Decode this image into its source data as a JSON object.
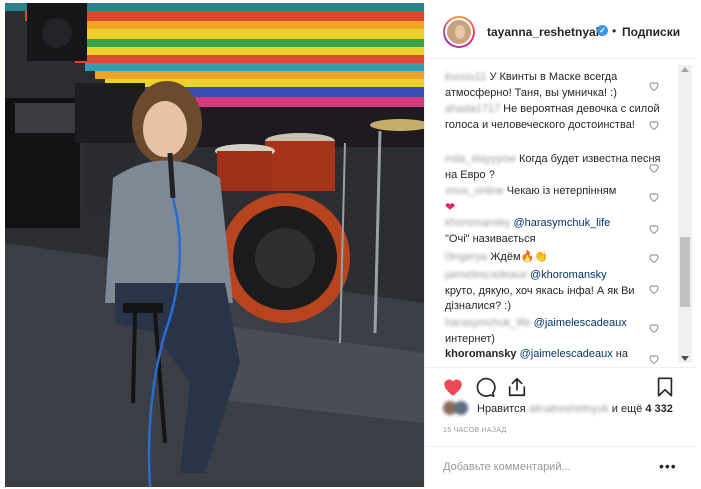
{
  "post": {
    "username": "tayanna_reshetnyak",
    "follow_label": "Подписки",
    "separator": "•",
    "verified_mark": "✓"
  },
  "comments": [
    {
      "user": "kuuuu11",
      "text": "У Квинты в Маске всегда атмосферно! Таня, вы умничка! :)",
      "user_blurred": true
    },
    {
      "user": "ahada1717",
      "text": "Не вероятная девочка с силой голоса и человеческого достоинства!",
      "user_blurred": true
    },
    {
      "user": "mila_slayyyow",
      "text": "Когда будет известна песня на Евро ?",
      "user_blurred": true
    },
    {
      "user": "vova_online",
      "text": "Чекаю із нетерпінням",
      "emoji": "❤",
      "user_blurred": true
    },
    {
      "user": "khoromansky",
      "mention": "@harasymchuk_life",
      "text": "\"Очі\" називається",
      "user_blurred": true
    },
    {
      "user": "l3ngerya",
      "text": "Ждём",
      "emoji": "🔥👏",
      "user_blurred": true
    },
    {
      "user": "jaimelescadeaux",
      "mention": "@khoromansky",
      "text": "круто, дякую, хоч якась інфа! А як Ви дізналися? :)",
      "user_blurred": true
    },
    {
      "user": "harasymchuk_life",
      "mention": "@jaimelescadeaux",
      "text": "интернет)",
      "user_blurred": true
    },
    {
      "user": "khoromansky",
      "mention": "@jaimelescadeaux",
      "text": "на",
      "user_blurred": false
    }
  ],
  "likes": {
    "prefix": "Нравится",
    "user": "alinatreshetnyuk",
    "suffix": "и ещё",
    "count": "4 332"
  },
  "timestamp": "15 ЧАСОВ НАЗАД",
  "add_comment": {
    "placeholder": "Добавьте комментарий...",
    "more_label": "•••"
  },
  "icons": {
    "like": "heart-filled-icon",
    "comment": "comment-icon",
    "share": "share-icon",
    "save": "bookmark-icon"
  },
  "colors": {
    "like_red": "#ed4956",
    "mention_blue": "#003569",
    "verified_blue": "#3897f0",
    "muted_gray": "#999999"
  }
}
